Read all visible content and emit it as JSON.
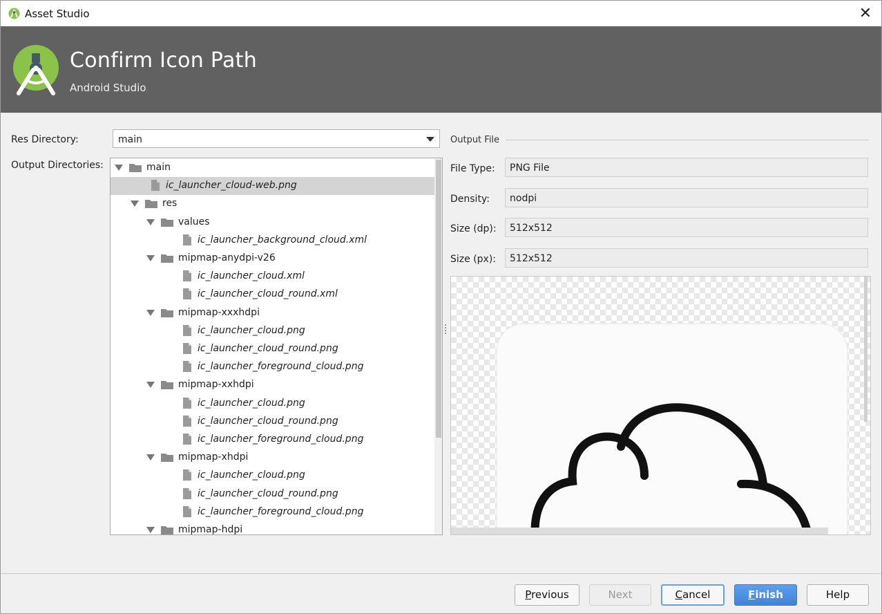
{
  "window": {
    "title": "Asset Studio"
  },
  "banner": {
    "title": "Confirm Icon Path",
    "subtitle": "Android Studio"
  },
  "form": {
    "res_directory_label": "Res Directory:",
    "res_directory_value": "main",
    "output_directories_label": "Output Directories:"
  },
  "tree": {
    "items": [
      {
        "label": "main",
        "type": "folder",
        "depth": 0,
        "expanded": true
      },
      {
        "label": "ic_launcher_cloud-web.png",
        "type": "file",
        "depth": 1,
        "selected": true
      },
      {
        "label": "res",
        "type": "folder",
        "depth": 1,
        "expanded": true
      },
      {
        "label": "values",
        "type": "folder",
        "depth": 2,
        "expanded": true
      },
      {
        "label": "ic_launcher_background_cloud.xml",
        "type": "file",
        "depth": 3
      },
      {
        "label": "mipmap-anydpi-v26",
        "type": "folder",
        "depth": 2,
        "expanded": true
      },
      {
        "label": "ic_launcher_cloud.xml",
        "type": "file",
        "depth": 3
      },
      {
        "label": "ic_launcher_cloud_round.xml",
        "type": "file",
        "depth": 3
      },
      {
        "label": "mipmap-xxxhdpi",
        "type": "folder",
        "depth": 2,
        "expanded": true
      },
      {
        "label": "ic_launcher_cloud.png",
        "type": "file",
        "depth": 3
      },
      {
        "label": "ic_launcher_cloud_round.png",
        "type": "file",
        "depth": 3
      },
      {
        "label": "ic_launcher_foreground_cloud.png",
        "type": "file",
        "depth": 3
      },
      {
        "label": "mipmap-xxhdpi",
        "type": "folder",
        "depth": 2,
        "expanded": true
      },
      {
        "label": "ic_launcher_cloud.png",
        "type": "file",
        "depth": 3
      },
      {
        "label": "ic_launcher_cloud_round.png",
        "type": "file",
        "depth": 3
      },
      {
        "label": "ic_launcher_foreground_cloud.png",
        "type": "file",
        "depth": 3
      },
      {
        "label": "mipmap-xhdpi",
        "type": "folder",
        "depth": 2,
        "expanded": true
      },
      {
        "label": "ic_launcher_cloud.png",
        "type": "file",
        "depth": 3
      },
      {
        "label": "ic_launcher_cloud_round.png",
        "type": "file",
        "depth": 3
      },
      {
        "label": "ic_launcher_foreground_cloud.png",
        "type": "file",
        "depth": 3
      },
      {
        "label": "mipmap-hdpi",
        "type": "folder",
        "depth": 2,
        "expanded": true
      }
    ]
  },
  "output_file": {
    "section_title": "Output File",
    "file_type_label": "File Type:",
    "file_type_value": "PNG File",
    "density_label": "Density:",
    "density_value": "nodpi",
    "size_dp_label": "Size (dp):",
    "size_dp_value": "512x512",
    "size_px_label": "Size (px):",
    "size_px_value": "512x512"
  },
  "buttons": {
    "previous": {
      "mnemonic": "P",
      "rest": "revious"
    },
    "next": "Next",
    "cancel": {
      "mnemonic": "C",
      "rest": "ancel"
    },
    "finish": {
      "mnemonic": "F",
      "rest": "inish"
    },
    "help": "Help"
  },
  "colors": {
    "banner": "#616161",
    "android_green": "#8bc34a",
    "primary_button": "#4a8ee0",
    "selection": "#d4d4d4"
  }
}
